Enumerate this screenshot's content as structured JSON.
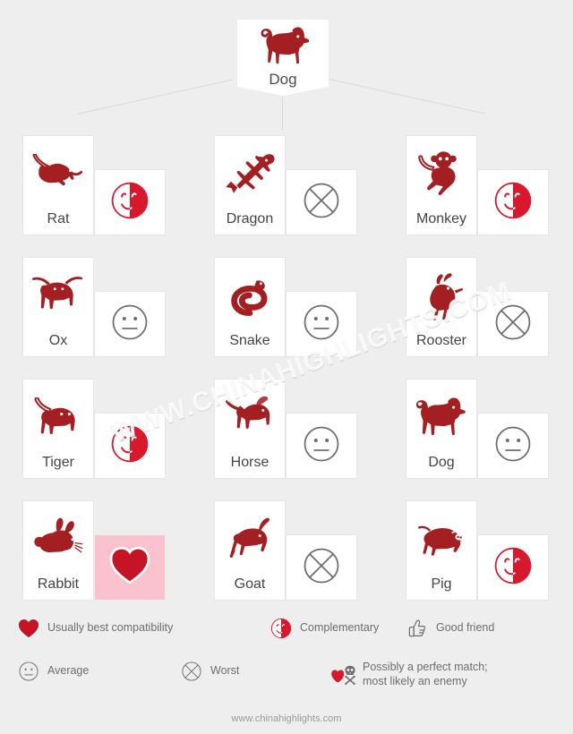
{
  "colors": {
    "animal_red": "#A31F22",
    "legend_red": "#D8182C",
    "heart_cell_bg": "#F9C2CE",
    "page_bg": "#EEEEEE",
    "gray_icon": "#6E6E6E",
    "card_bg": "#FFFFFF"
  },
  "center": {
    "name": "Dog",
    "icon": "dog-icon"
  },
  "columns": [
    {
      "items": [
        {
          "name": "Rat",
          "animal_icon": "rat-icon",
          "compat": "Complementary",
          "compat_icon": "complementary-icon"
        },
        {
          "name": "Ox",
          "animal_icon": "ox-icon",
          "compat": "Average",
          "compat_icon": "average-icon"
        },
        {
          "name": "Tiger",
          "animal_icon": "tiger-icon",
          "compat": "Complementary",
          "compat_icon": "complementary-icon"
        },
        {
          "name": "Rabbit",
          "animal_icon": "rabbit-icon",
          "compat": "Usually best compatibility",
          "compat_icon": "heart-icon"
        }
      ]
    },
    {
      "items": [
        {
          "name": "Dragon",
          "animal_icon": "dragon-icon",
          "compat": "Worst",
          "compat_icon": "worst-icon"
        },
        {
          "name": "Snake",
          "animal_icon": "snake-icon",
          "compat": "Average",
          "compat_icon": "average-icon"
        },
        {
          "name": "Horse",
          "animal_icon": "horse-icon",
          "compat": "Average",
          "compat_icon": "average-icon"
        },
        {
          "name": "Goat",
          "animal_icon": "goat-icon",
          "compat": "Worst",
          "compat_icon": "worst-icon"
        }
      ]
    },
    {
      "items": [
        {
          "name": "Monkey",
          "animal_icon": "monkey-icon",
          "compat": "Complementary",
          "compat_icon": "complementary-icon"
        },
        {
          "name": "Rooster",
          "animal_icon": "rooster-icon",
          "compat": "Worst",
          "compat_icon": "worst-icon"
        },
        {
          "name": "Dog",
          "animal_icon": "dog-icon",
          "compat": "Average",
          "compat_icon": "average-icon"
        },
        {
          "name": "Pig",
          "animal_icon": "pig-icon",
          "compat": "Complementary",
          "compat_icon": "complementary-icon"
        }
      ]
    }
  ],
  "legend": {
    "row1": [
      {
        "icon": "heart-icon",
        "label": "Usually best compatibility"
      },
      {
        "icon": "complementary-icon",
        "label": "Complementary"
      },
      {
        "icon": "thumbs-up-icon",
        "label": "Good friend"
      }
    ],
    "row2": [
      {
        "icon": "average-icon",
        "label": "Average"
      },
      {
        "icon": "worst-icon",
        "label": "Worst"
      },
      {
        "icon": "heart-skull-icon",
        "label": "Possibly a perfect match; most likely an enemy",
        "line1": "Possibly a perfect match;",
        "line2": "most likely an enemy"
      }
    ]
  },
  "watermark": "WWW.CHINAHIGHLIGHTS.COM",
  "footer": "www.chinahighlights.com"
}
